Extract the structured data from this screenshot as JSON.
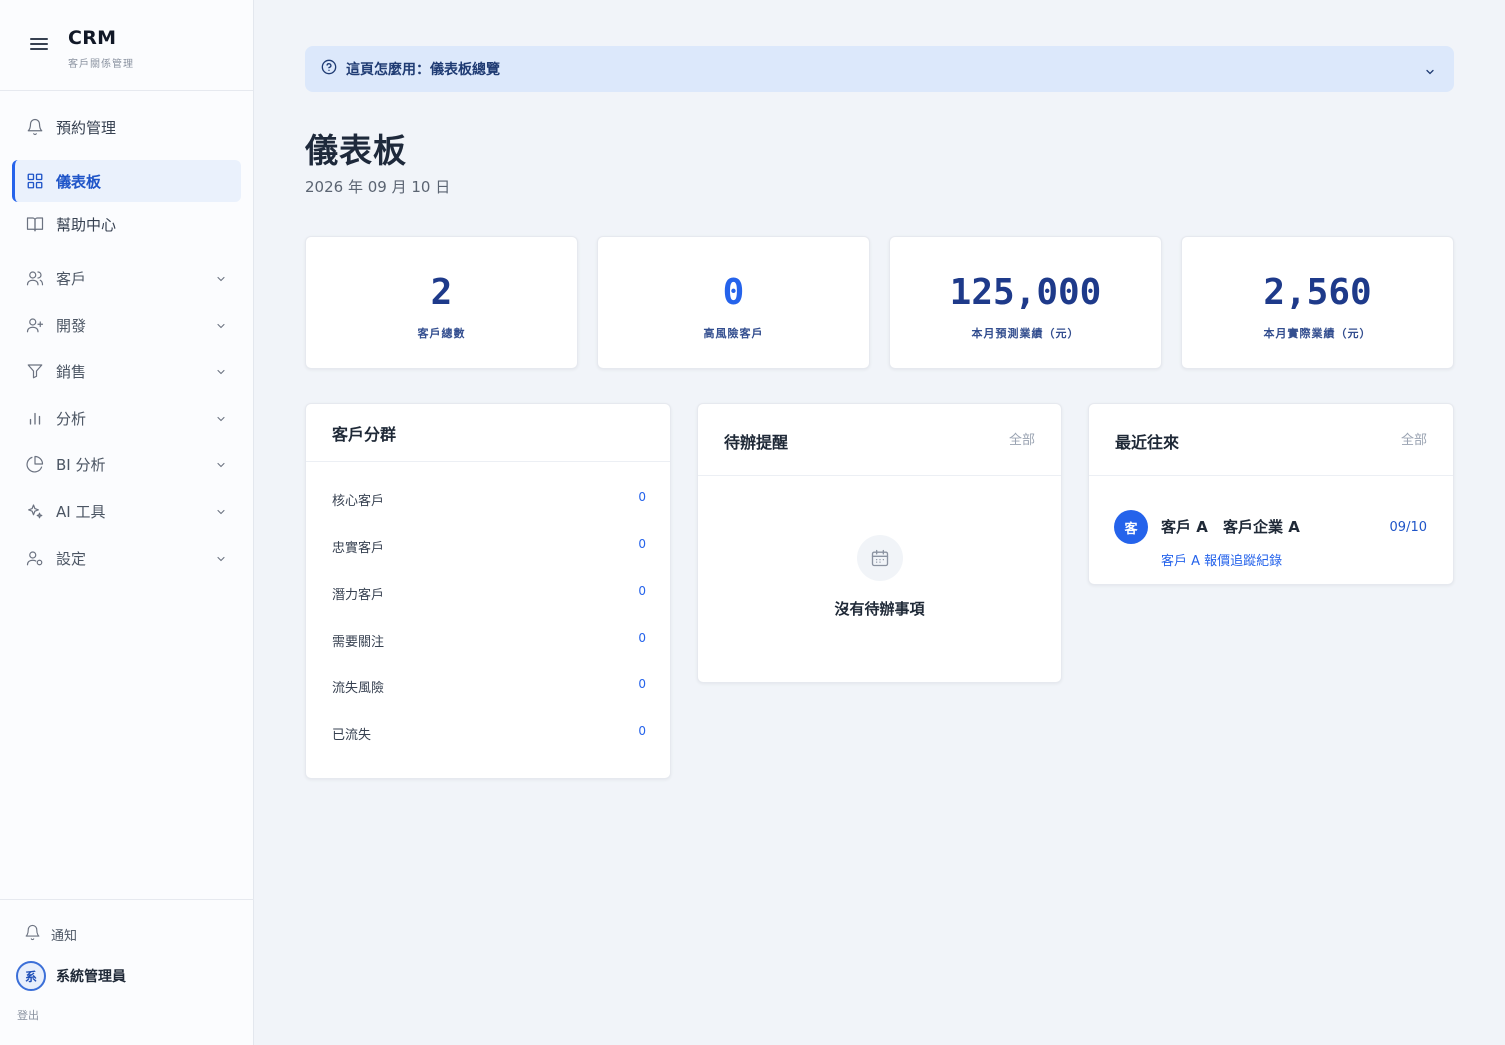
{
  "app": {
    "title": "CRM",
    "subtitle": "客戶關係管理"
  },
  "sidebar": {
    "items": [
      {
        "label": "預約管理",
        "icon": "bell-icon"
      },
      {
        "label": "儀表板",
        "icon": "grid-icon",
        "active": true
      },
      {
        "label": "幫助中心",
        "icon": "book-icon"
      }
    ],
    "groups": [
      {
        "label": "客戶",
        "icon": "users-icon"
      },
      {
        "label": "開發",
        "icon": "user-plus-icon"
      },
      {
        "label": "銷售",
        "icon": "filter-icon"
      },
      {
        "label": "分析",
        "icon": "bar-chart-icon"
      },
      {
        "label": "BI 分析",
        "icon": "pie-chart-icon"
      },
      {
        "label": "AI 工具",
        "icon": "sparkles-icon"
      },
      {
        "label": "設定",
        "icon": "user-settings-icon"
      }
    ],
    "notify_label": "通知",
    "user": {
      "initial": "系",
      "name": "系統管理員"
    },
    "logout_label": "登出"
  },
  "help": {
    "text": "這頁怎麼用：儀表板總覽"
  },
  "page": {
    "title": "儀表板",
    "date": "2026 年 09 月 10 日"
  },
  "stats": [
    {
      "value": "2",
      "label": "客戶總數"
    },
    {
      "value": "0",
      "label": "高風險客戶"
    },
    {
      "value": "125,000",
      "label": "本月預測業績（元）"
    },
    {
      "value": "2,560",
      "label": "本月實際業績（元）"
    }
  ],
  "segments": {
    "title": "客戶分群",
    "rows": [
      {
        "label": "核心客戶",
        "value": "0"
      },
      {
        "label": "忠實客戶",
        "value": "0"
      },
      {
        "label": "潛力客戶",
        "value": "0"
      },
      {
        "label": "需要關注",
        "value": "0"
      },
      {
        "label": "流失風險",
        "value": "0"
      },
      {
        "label": "已流失",
        "value": "0"
      }
    ]
  },
  "todo": {
    "title": "待辦提醒",
    "link": "全部",
    "empty_text": "沒有待辦事項"
  },
  "recent": {
    "title": "最近往來",
    "link": "全部",
    "items": [
      {
        "initial": "客",
        "name": "客戶 A",
        "company": "客戶企業 A",
        "date": "09/10",
        "desc": "客戶 A 報價追蹤紀錄"
      }
    ]
  },
  "colors": {
    "accent": "#2563eb",
    "help_bg": "#dce8fb",
    "page_bg": "#f1f4f9"
  }
}
